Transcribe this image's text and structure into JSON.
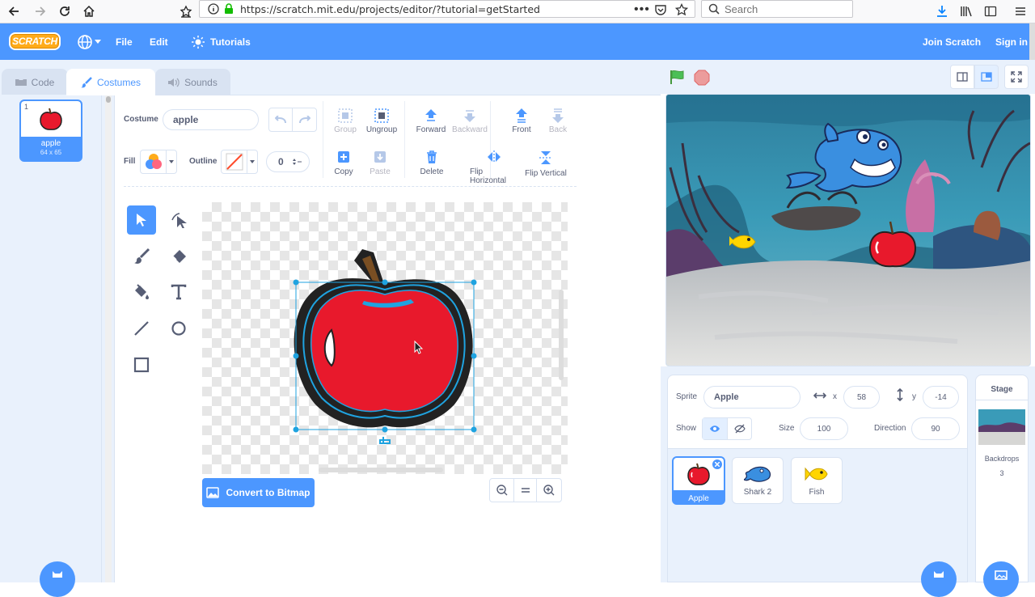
{
  "browser": {
    "url": "https://scratch.mit.edu/projects/editor/?tutorial=getStarted",
    "search_placeholder": "Search"
  },
  "menubar": {
    "logo": "SCRATCH",
    "file": "File",
    "edit": "Edit",
    "tutorials": "Tutorials",
    "join": "Join Scratch",
    "signin": "Sign in"
  },
  "tabs": {
    "code": "Code",
    "costumes": "Costumes",
    "sounds": "Sounds"
  },
  "costume_list": [
    {
      "index": "1",
      "name": "apple",
      "size": "64 x 65"
    }
  ],
  "paint": {
    "costume_label": "Costume",
    "costume_name": "apple",
    "fill_label": "Fill",
    "outline_label": "Outline",
    "outline_width": "0",
    "toolbar": {
      "group": "Group",
      "ungroup": "Ungroup",
      "forward": "Forward",
      "backward": "Backward",
      "front": "Front",
      "back": "Back",
      "copy": "Copy",
      "paste": "Paste",
      "delete": "Delete",
      "flip_h": "Flip Horizontal",
      "flip_v": "Flip Vertical"
    },
    "convert": "Convert to Bitmap"
  },
  "sprite_info": {
    "sprite_label": "Sprite",
    "sprite_name": "Apple",
    "x_label": "x",
    "x": "58",
    "y_label": "y",
    "y": "-14",
    "show_label": "Show",
    "size_label": "Size",
    "size": "100",
    "direction_label": "Direction",
    "direction": "90"
  },
  "sprites": [
    {
      "name": "Apple"
    },
    {
      "name": "Shark 2"
    },
    {
      "name": "Fish"
    }
  ],
  "stage_panel": {
    "title": "Stage",
    "backdrops_label": "Backdrops",
    "backdrops_count": "3"
  },
  "colors": {
    "primary": "#4c97ff",
    "apple_red": "#e8192c",
    "shark_blue": "#3a8fe0",
    "fish_yellow": "#ffd500"
  }
}
